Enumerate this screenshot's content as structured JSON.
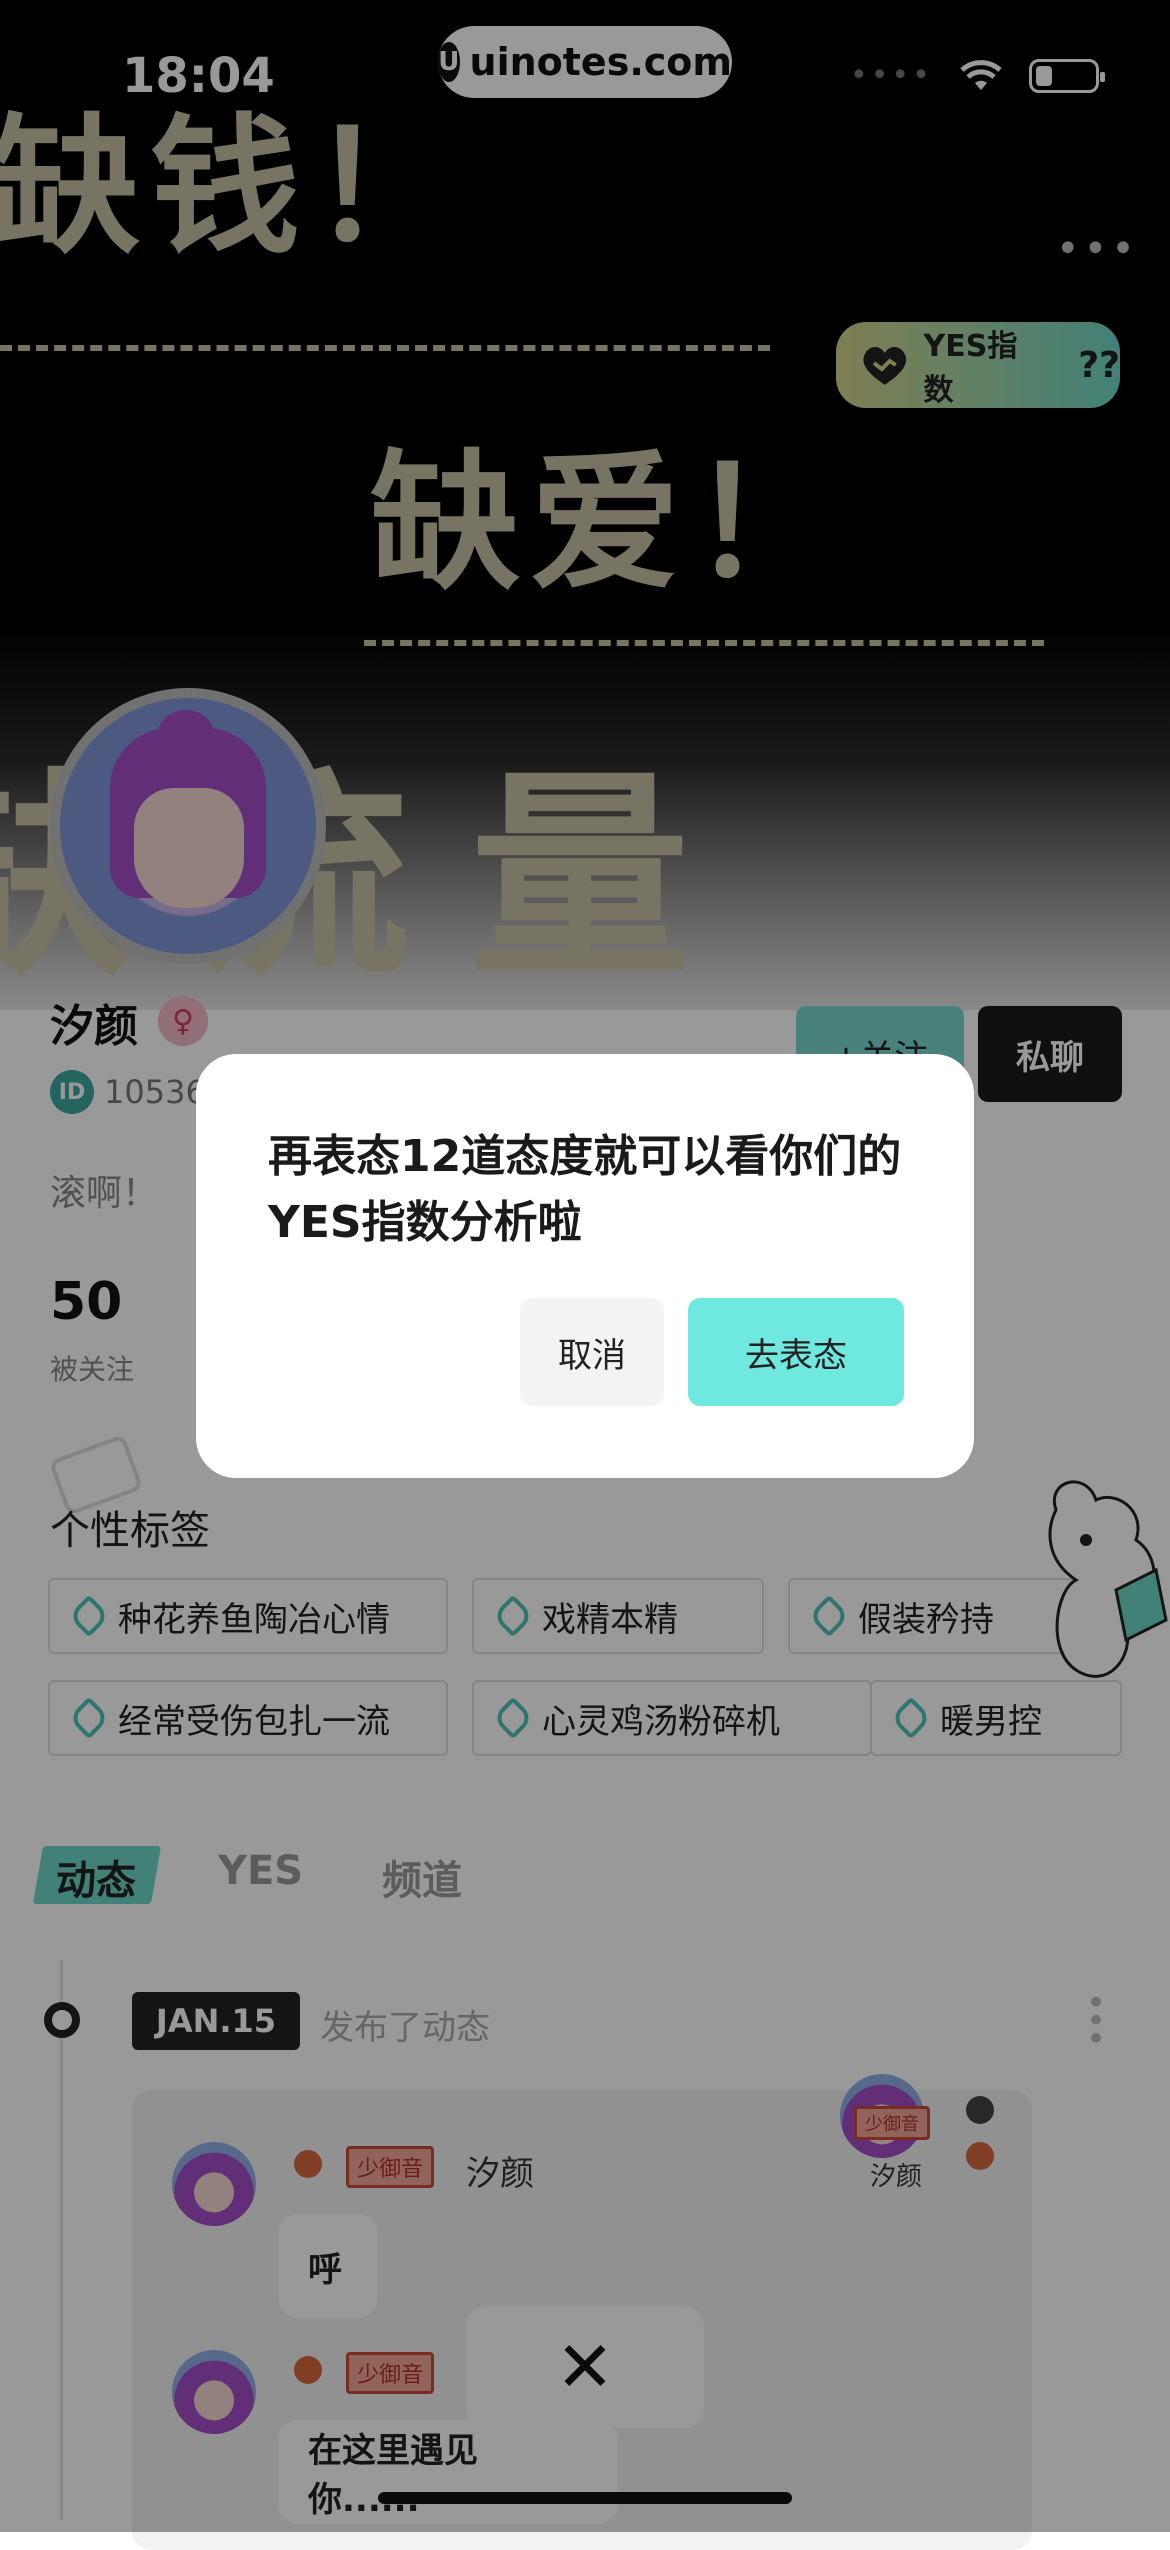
{
  "status_bar": {
    "time": "18:04",
    "url": "uinotes.com"
  },
  "header": {
    "banner_lines": [
      "缺钱！",
      "缺爱！",
      "缺流量"
    ],
    "more_label": "•••",
    "yes_badge_label": "YES指数",
    "yes_badge_value": "??"
  },
  "profile": {
    "name": "汐颜",
    "gender_symbol": "♀",
    "id_label": "ID",
    "id_number": "10536",
    "bio": "滚啊！",
    "follow_label": "+关注",
    "chat_label": "私聊",
    "followers_count": "50",
    "followers_label": "被关注"
  },
  "tags": {
    "title": "个性标签",
    "row1": [
      "种花养鱼陶冶心情",
      "戏精本精",
      "假装矜持"
    ],
    "row2": [
      "经常受伤包扎一流",
      "心灵鸡汤粉碎机",
      "暖男控"
    ]
  },
  "tabs": [
    "动态",
    "YES",
    "频道"
  ],
  "feed": {
    "date": "JAN.15",
    "action": "发布了动态",
    "posts": [
      {
        "voice_tag": "少御音",
        "name": "汐颜",
        "text": "呼"
      },
      {
        "voice_tag": "少御音",
        "name": "",
        "text": "在这里遇见你......"
      }
    ],
    "side_name": "汐颜",
    "side_voice_tag": "少御音"
  },
  "close_label": "✕",
  "dialog": {
    "message": "再表态12道态度就可以看你们的YES指数分析啦",
    "cancel_label": "取消",
    "confirm_label": "去表态"
  },
  "colors": {
    "accent": "#6fe8df",
    "teal": "#6fd7c7",
    "dark": "#1a1a1a"
  }
}
